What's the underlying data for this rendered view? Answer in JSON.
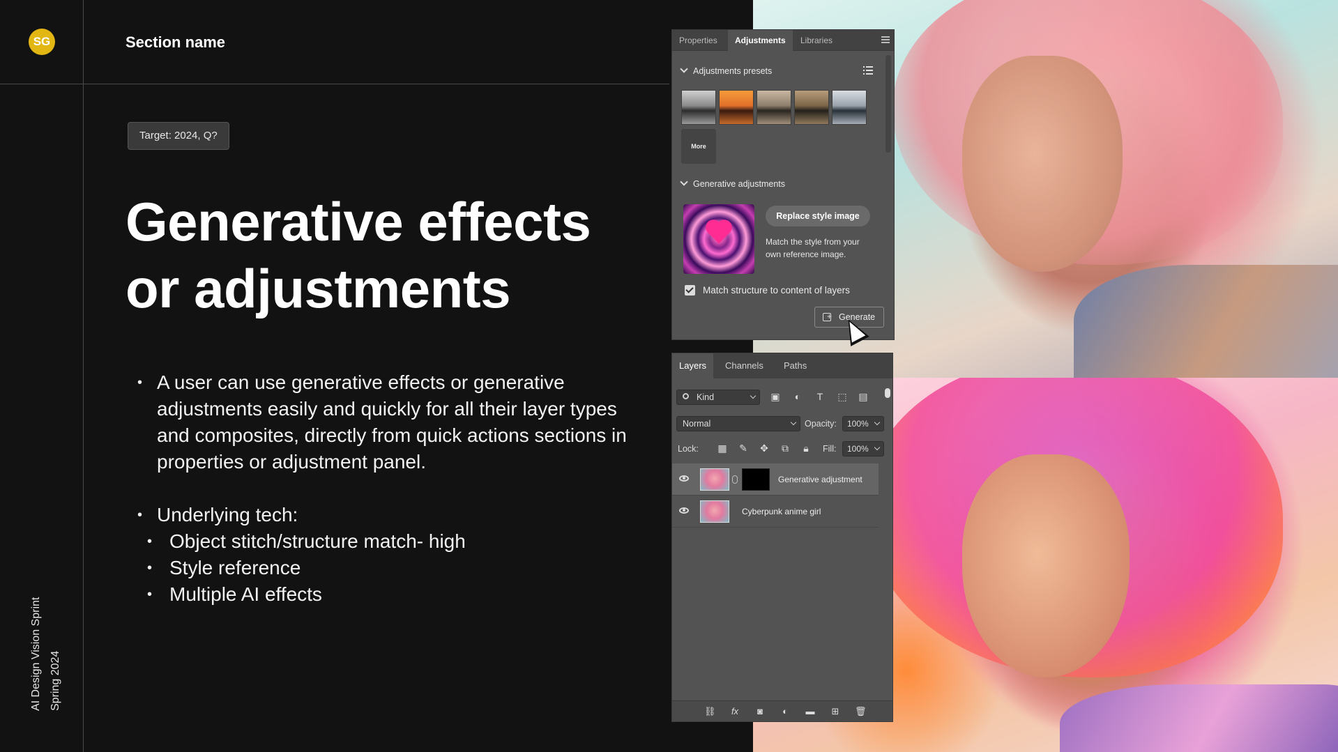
{
  "slide": {
    "logo": "SG",
    "section_name": "Section name",
    "target_badge": "Target: 2024, Q?",
    "headline_line1": "Generative effects",
    "headline_line2": "or adjustments",
    "bullet1": "A user can use generative effects or generative adjustments easily and quickly for all their layer types and composites, directly from quick actions sections in properties or adjustment panel.",
    "bullet2": "Underlying tech:",
    "sub_bullets": [
      "Object stitch/structure match- high",
      "Style reference",
      "Multiple AI effects"
    ],
    "footer_line1": "AI Design Vision Sprint",
    "footer_line2": "Spring 2024",
    "accent_color": "#e2b714"
  },
  "adjustments_panel": {
    "tabs": [
      "Properties",
      "Adjustments",
      "Libraries"
    ],
    "active_tab": "Adjustments",
    "presets_heading": "Adjustments presets",
    "more_label": "More",
    "generative_heading": "Generative adjustments",
    "replace_button": "Replace style image",
    "style_description": "Match the style from your own reference image.",
    "checkbox_label": "Match structure to content of layers",
    "checkbox_checked": true,
    "generate_button": "Generate"
  },
  "layers_panel": {
    "tabs": [
      "Layers",
      "Channels",
      "Paths"
    ],
    "active_tab": "Layers",
    "filter_kind": "Kind",
    "blend_mode": "Normal",
    "opacity_label": "Opacity:",
    "opacity_value": "100%",
    "lock_label": "Lock:",
    "fill_label": "Fill:",
    "fill_value": "100%",
    "layers": [
      {
        "name": "Generative adjustment",
        "visible": true,
        "selected": true
      },
      {
        "name": "Cyberpunk anime girl",
        "visible": true,
        "selected": false
      }
    ]
  }
}
